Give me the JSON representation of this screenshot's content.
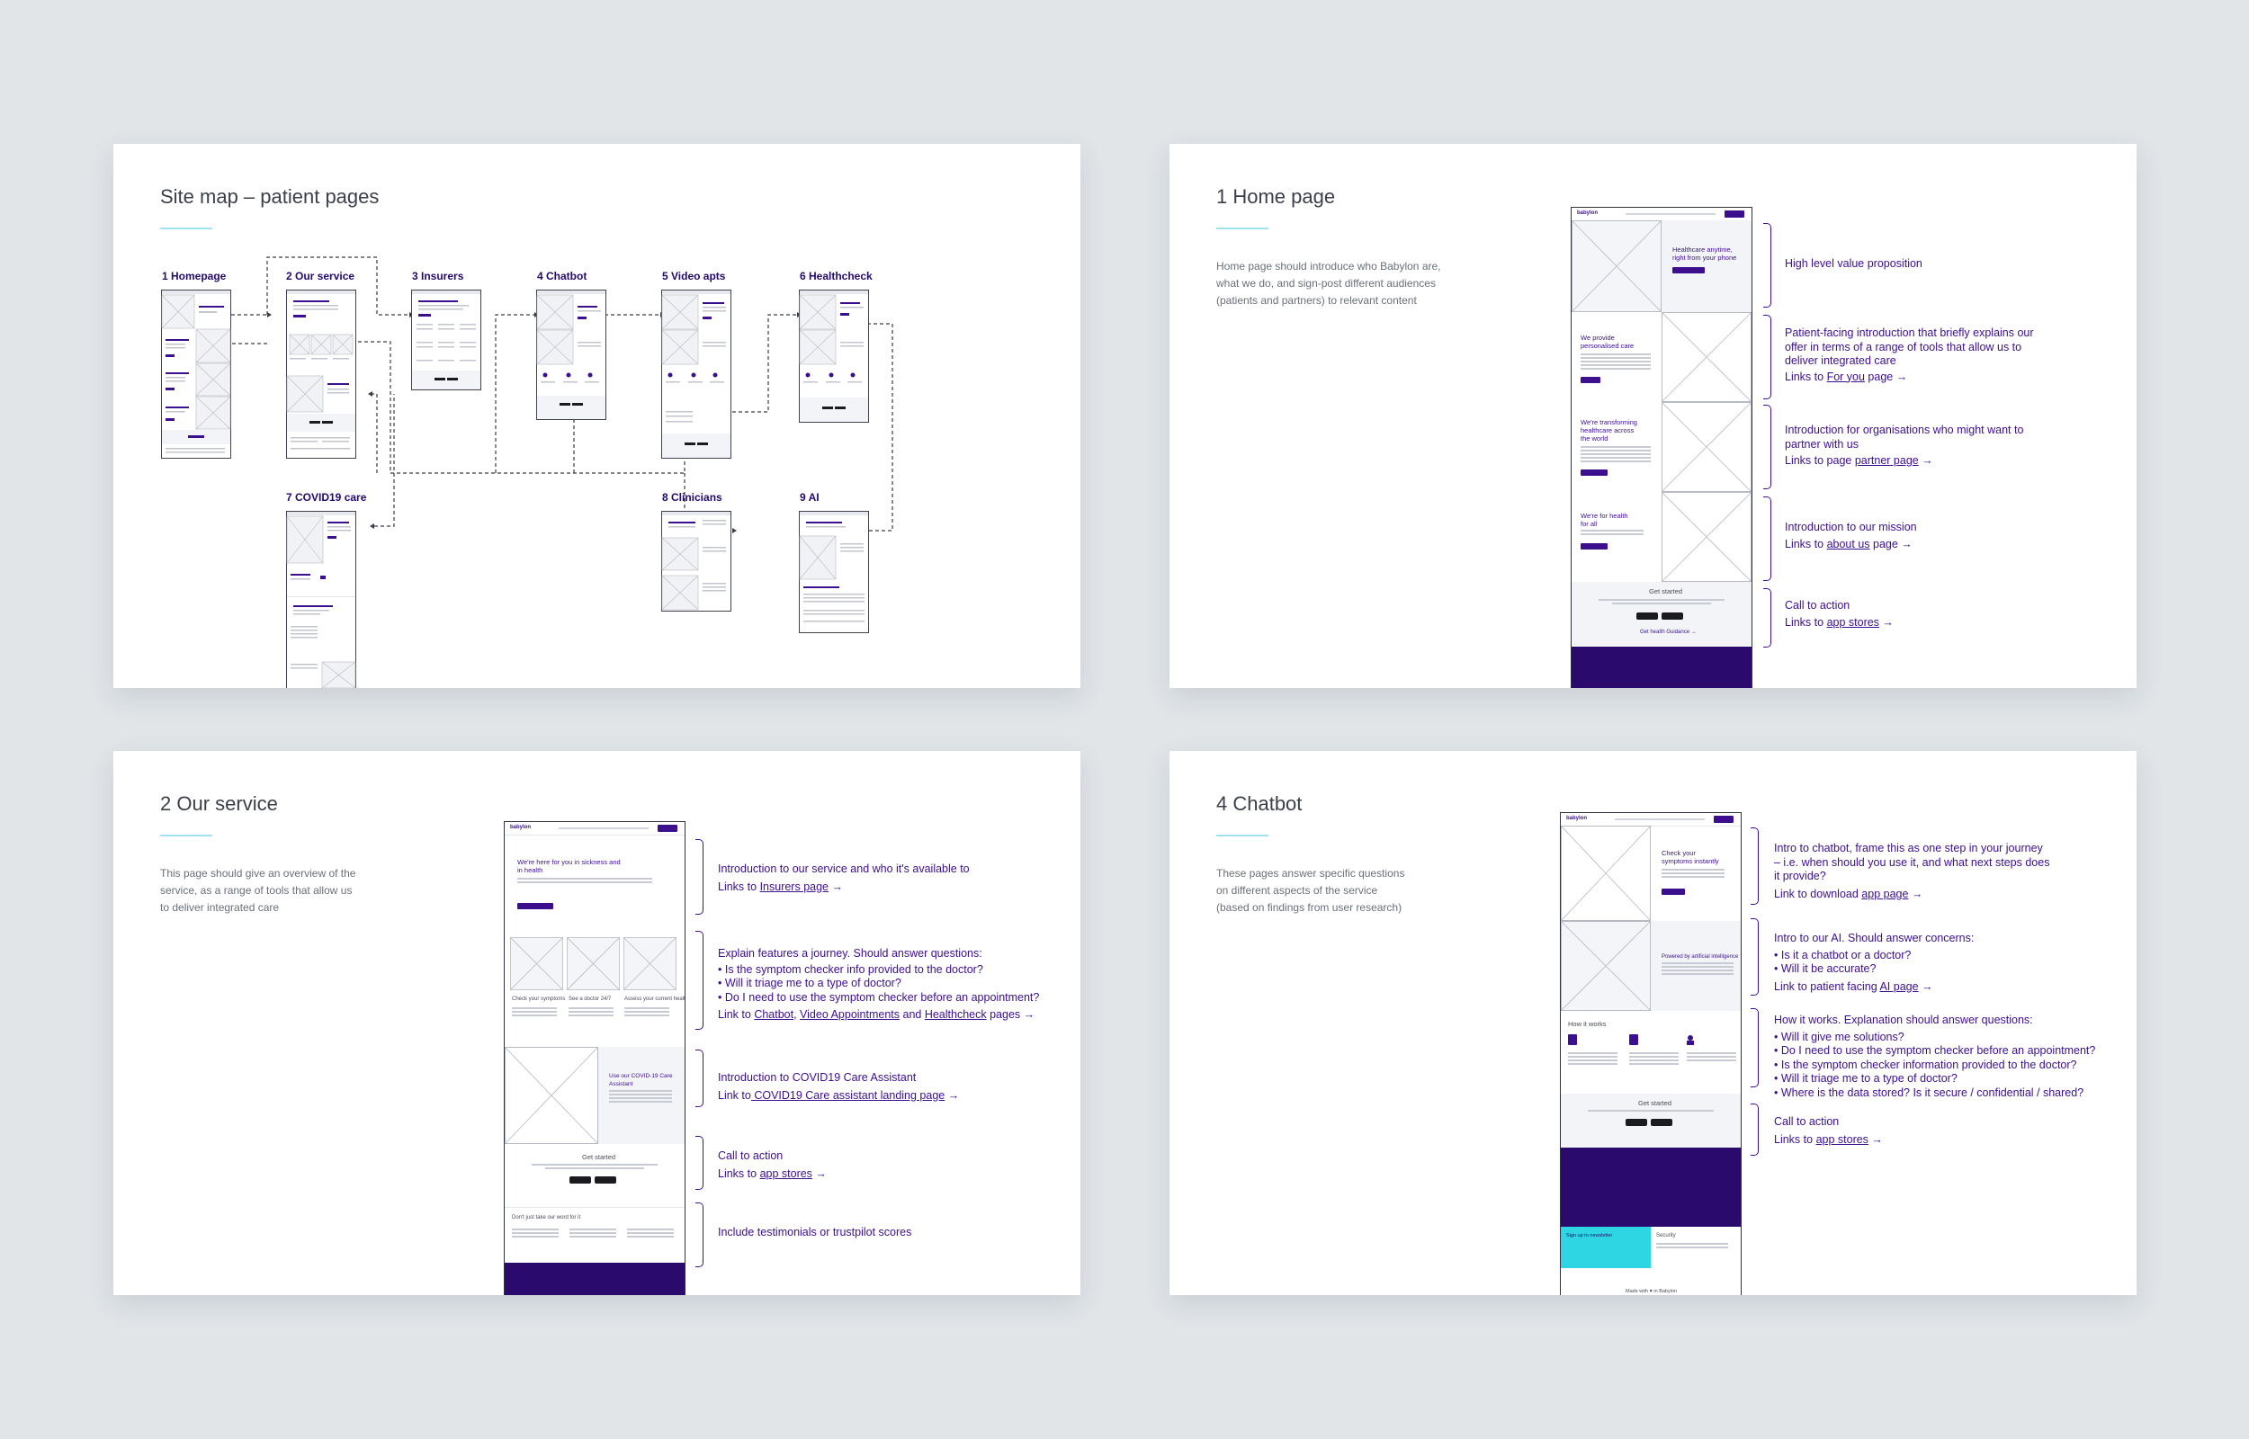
{
  "slides": {
    "sitemap": {
      "title": "Site map – patient pages",
      "pages": [
        "1 Homepage",
        "2 Our service",
        "3 Insurers",
        "4 Chatbot",
        "5 Video apts",
        "6 Healthcheck",
        "7 COVID19 care",
        "8 Clinicians",
        "9 AI"
      ]
    },
    "home": {
      "title": "1 Home page",
      "description": [
        "Home page should introduce who Babylon are,",
        "what we do, and sign-post different audiences",
        "(patients and partners) to relevant content"
      ],
      "mock": {
        "logo": "babylon",
        "hero": [
          "Healthcare anytime,",
          "right from your phone"
        ],
        "s1": [
          "We provide",
          "personalised care"
        ],
        "s2": [
          "We're transforming",
          "healthcare across",
          "the world"
        ],
        "s3": [
          "We're for health",
          "for all"
        ],
        "cta": "Get started",
        "cta_link": "Get health Guidance →"
      },
      "notes": {
        "n1": "High level value proposition",
        "n2": [
          "Patient-facing introduction that briefly explains our",
          "offer in terms of a range of tools that allow us to",
          "deliver integrated care"
        ],
        "n2_prefix": "Links to ",
        "n2_link": "For you",
        "n2_suffix": " page →",
        "n3": [
          "Introduction for organisations who might want to",
          "partner with us"
        ],
        "n3_prefix": "Links to page ",
        "n3_link": "partner page",
        "n3_suffix": " →",
        "n4": "Introduction to our mission",
        "n4_prefix": "Links to ",
        "n4_link": "about us",
        "n4_suffix": " page  →",
        "n5": "Call to action",
        "n5_prefix": "Links to ",
        "n5_link": "app stores",
        "n5_suffix": "  →"
      }
    },
    "service": {
      "title": "2 Our service",
      "description": [
        "This page should give an overview of the",
        "service, as a range of tools that allow us",
        "to deliver integrated care"
      ],
      "mock": {
        "logo": "babylon",
        "hero": [
          "We're here for you in sickness and",
          "in health"
        ],
        "cards": [
          "Check your symptoms",
          "See a doctor 24/7",
          "Assess your current health"
        ],
        "covid": [
          "Use our COVID-19 Care",
          "Assistant"
        ],
        "cta": "Get started",
        "reviews": "Don't just take our word for it"
      },
      "notes": {
        "n1": "Introduction to our service and who it's available to",
        "n1_prefix": "Links to ",
        "n1_link": "Insurers page",
        "n1_suffix": "  →",
        "n2": "Explain features a journey. Should answer questions:",
        "n2_bullets": [
          "• Is the symptom checker info provided to the doctor?",
          "• Will it triage me to a type of doctor?",
          "• Do I need to use the symptom checker before an appointment?"
        ],
        "n2_prefix": "Link to ",
        "n2_link1": "Chatbot",
        "n2_sep1": ", ",
        "n2_link2": "Video Appointments",
        "n2_sep2": " and ",
        "n2_link3": "Healthcheck",
        "n2_suffix": " pages   →",
        "n3": "Introduction to COVID19 Care Assistant",
        "n3_prefix": "Link to",
        "n3_link": " COVID19 Care assistant landing page",
        "n3_suffix": "  →",
        "n4": "Call to action",
        "n4_prefix": "Links to ",
        "n4_link": "app stores",
        "n4_suffix": "  →",
        "n5": "Include testimonials or trustpilot scores"
      }
    },
    "chatbot": {
      "title": "4 Chatbot",
      "description": [
        "These pages answer specific questions",
        "on different aspects of the service",
        "(based on findings from user research)"
      ],
      "mock": {
        "logo": "babylon",
        "hero": [
          "Check your",
          "symptoms instantly"
        ],
        "ai": "Powered by artificial intelligence",
        "how": "How it works",
        "cta": "Get started",
        "signup": "Sign up to newsletter",
        "security": "Security",
        "made": "Made with ♥ in Babylon"
      },
      "notes": {
        "n1": [
          "Intro to chatbot, frame this as one step in your journey",
          "– i.e. when should you use it, and what next steps does",
          "it provide?"
        ],
        "n1_prefix": "Link to download ",
        "n1_link": "app page",
        "n1_suffix": " →",
        "n2": "Intro to our AI. Should answer concerns:",
        "n2_bullets": [
          "• Is it a chatbot or a doctor?",
          "• Will it be accurate?"
        ],
        "n2_prefix": "Link to patient facing ",
        "n2_link": "AI page",
        "n2_suffix": " →",
        "n3": "How it works. Explanation should answer questions:",
        "n3_bullets": [
          "• Will it give me solutions?",
          "• Do I need to use the symptom checker before an appointment?",
          "• Is the symptom checker information provided  to the doctor?",
          "• Will it triage me to a type of doctor?",
          "• Where is the data stored? Is it secure / confidential / shared?"
        ],
        "n4": "Call to action",
        "n4_prefix": "Links to ",
        "n4_link": "app stores",
        "n4_suffix": " →"
      }
    }
  },
  "colors": {
    "background": "#e1e5e8",
    "brand_purple": "#3c0f8f",
    "accent_cyan": "#9fe4ee"
  }
}
